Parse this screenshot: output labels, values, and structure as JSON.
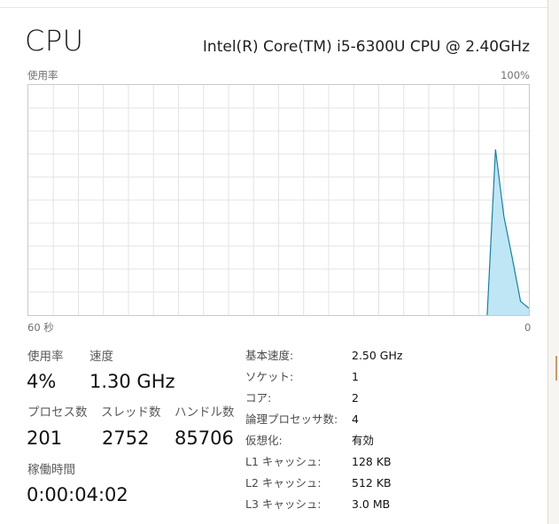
{
  "header": {
    "title": "CPU",
    "cpu_name": "Intel(R) Core(TM) i5-6300U CPU @ 2.40GHz"
  },
  "graph": {
    "y_label": "使用率",
    "y_max_label": "100%",
    "x_left_label": "60 秒",
    "x_right_label": "0",
    "line_color": "#1a7fa0",
    "fill_color": "#bfe6f5",
    "grid_color": "#e3e3e3",
    "series_percent": [
      0,
      0,
      0,
      0,
      0,
      0,
      0,
      0,
      0,
      0,
      0,
      0,
      0,
      0,
      0,
      0,
      0,
      0,
      0,
      0,
      0,
      0,
      0,
      0,
      0,
      0,
      0,
      0,
      0,
      0,
      0,
      0,
      0,
      0,
      0,
      0,
      0,
      0,
      0,
      0,
      0,
      0,
      0,
      0,
      0,
      0,
      0,
      0,
      0,
      0,
      0,
      0,
      0,
      0,
      0,
      0,
      72,
      43,
      25,
      6,
      3
    ]
  },
  "stats": {
    "usage_label": "使用率",
    "usage_value": "4%",
    "speed_label": "速度",
    "speed_value": "1.30 GHz",
    "processes_label": "プロセス数",
    "processes_value": "201",
    "threads_label": "スレッド数",
    "threads_value": "2752",
    "handles_label": "ハンドル数",
    "handles_value": "85706",
    "uptime_label": "稼働時間",
    "uptime_value": "0:00:04:02"
  },
  "info": [
    {
      "key": "基本速度:",
      "value": "2.50 GHz"
    },
    {
      "key": "ソケット:",
      "value": "1"
    },
    {
      "key": "コア:",
      "value": "2"
    },
    {
      "key": "論理プロセッサ数:",
      "value": "4"
    },
    {
      "key": "仮想化:",
      "value": "有効"
    },
    {
      "key": "L1 キャッシュ:",
      "value": "128 KB"
    },
    {
      "key": "L2 キャッシュ:",
      "value": "512 KB"
    },
    {
      "key": "L3 キャッシュ:",
      "value": "3.0 MB"
    }
  ]
}
